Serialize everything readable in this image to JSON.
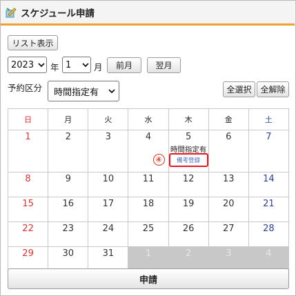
{
  "header": {
    "title": "スケジュール申請"
  },
  "toolbar": {
    "list_button": "リスト表示",
    "year_value": "2023",
    "year_label": "年",
    "month_value": "1",
    "month_label": "月",
    "prev_button": "前月",
    "next_button": "翌月",
    "reservation_label": "予約区分",
    "reservation_value": "時間指定有",
    "select_all_button": "全選択",
    "clear_all_button": "全解除"
  },
  "calendar": {
    "weekdays": [
      "日",
      "月",
      "火",
      "水",
      "木",
      "金",
      "土"
    ],
    "weeks": [
      [
        {
          "day": "1"
        },
        {
          "day": "2"
        },
        {
          "day": "3"
        },
        {
          "day": "4"
        },
        {
          "day": "5",
          "note": "時間指定有",
          "link": "備考登録",
          "marker": "④"
        },
        {
          "day": "6"
        },
        {
          "day": "7"
        }
      ],
      [
        {
          "day": "8"
        },
        {
          "day": "9"
        },
        {
          "day": "10"
        },
        {
          "day": "11"
        },
        {
          "day": "12"
        },
        {
          "day": "13"
        },
        {
          "day": "14"
        }
      ],
      [
        {
          "day": "15"
        },
        {
          "day": "16"
        },
        {
          "day": "17"
        },
        {
          "day": "18"
        },
        {
          "day": "19"
        },
        {
          "day": "20"
        },
        {
          "day": "21"
        }
      ],
      [
        {
          "day": "22"
        },
        {
          "day": "23"
        },
        {
          "day": "24"
        },
        {
          "day": "25"
        },
        {
          "day": "26"
        },
        {
          "day": "27"
        },
        {
          "day": "28"
        }
      ],
      [
        {
          "day": "29"
        },
        {
          "day": "30"
        },
        {
          "day": "31"
        },
        {
          "day": "1",
          "other": true
        },
        {
          "day": "2",
          "other": true
        },
        {
          "day": "3",
          "other": true
        },
        {
          "day": "4",
          "other": true
        }
      ]
    ]
  },
  "footer": {
    "submit_button": "申請"
  },
  "colors": {
    "accent": "#f0a030",
    "sunday": "#e03030",
    "saturday": "#2c3f9c",
    "highlight": "#e8131f"
  },
  "icons": {
    "app": "pencil-notes-icon",
    "dropdown": "chevron-down-icon"
  }
}
